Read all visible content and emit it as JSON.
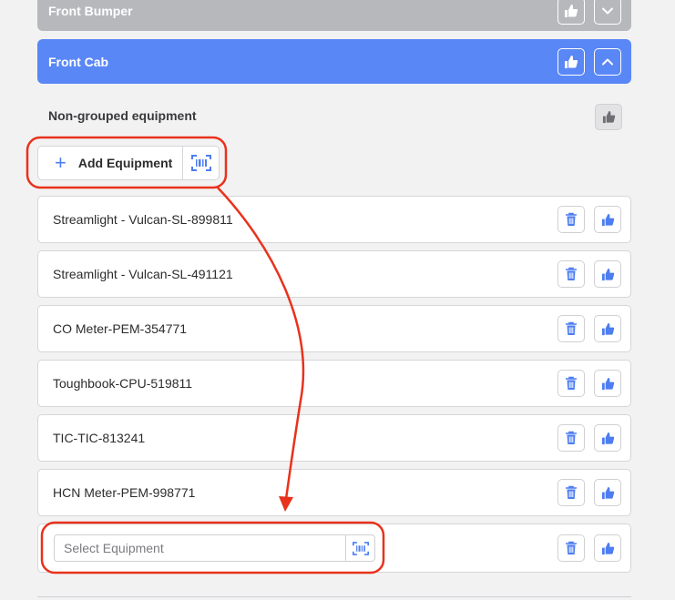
{
  "sections": {
    "front_bumper": {
      "title": "Front Bumper"
    },
    "front_cab": {
      "title": "Front Cab"
    }
  },
  "group": {
    "label": "Non-grouped equipment"
  },
  "add_equipment": {
    "label": "Add Equipment"
  },
  "equipment": [
    {
      "name": "Streamlight - Vulcan-SL-899811"
    },
    {
      "name": "Streamlight - Vulcan-SL-491121"
    },
    {
      "name": "CO Meter-PEM-354771"
    },
    {
      "name": "Toughbook-CPU-519811"
    },
    {
      "name": "TIC-TIC-813241"
    },
    {
      "name": "HCN Meter-PEM-998771"
    }
  ],
  "new_row": {
    "placeholder": "Select Equipment",
    "value": ""
  },
  "icons": {
    "like": "thumbs-up-icon",
    "expand": "chevron-down-icon",
    "collapse": "chevron-up-icon",
    "delete": "trash-icon",
    "scan": "barcode-scan-icon",
    "add": "plus-icon"
  },
  "colors": {
    "accent": "#5a87f6",
    "icon_blue": "#4d7df0",
    "collapsed_bar": "#b7b8bc",
    "annotation_red": "#e8321c"
  }
}
